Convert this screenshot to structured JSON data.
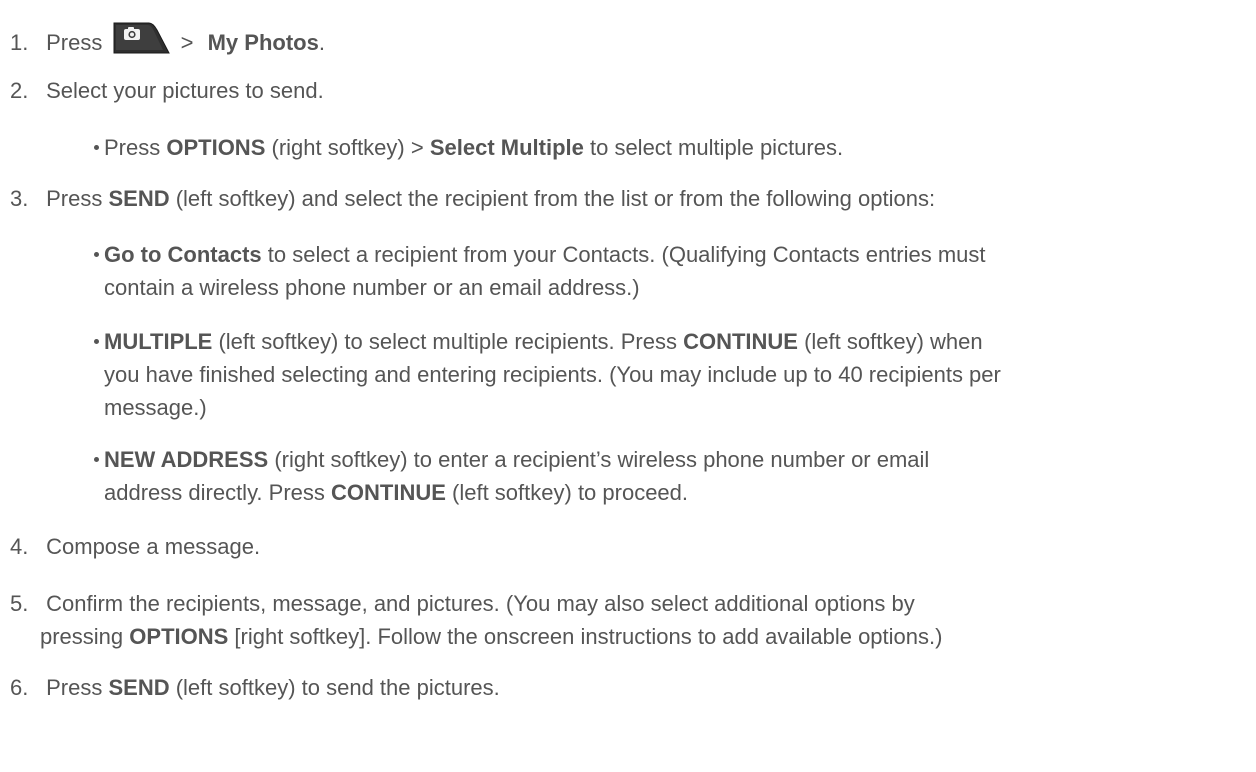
{
  "steps": [
    {
      "num": "1.",
      "pre": "Press",
      "key_icon": "camera-key-icon",
      "sep": ">",
      "bold": "My Photos",
      "post": "."
    },
    {
      "num": "2.",
      "text": "Select your pictures to send.",
      "bullets": [
        {
          "t1": "Press ",
          "b1": "OPTIONS",
          "t2": " (right softkey) > ",
          "b2": "Select Multiple",
          "t3": " to select multiple pictures."
        }
      ]
    },
    {
      "num": "3.",
      "pre": "Press ",
      "bold": "SEND",
      "post": " (left softkey) and select the recipient from the list or from the following options:",
      "bullets": [
        {
          "b1": "Go to Contacts",
          "t1": " to select a recipient from your Contacts. (Qualifying Contacts entries must",
          "t2": "contain a wireless phone number or an email address.)"
        },
        {
          "b1": "MULTIPLE",
          "t1": " (left softkey) to select multiple recipients. Press ",
          "b2": "CONTINUE",
          "t2": " (left softkey) when",
          "t3": "you have finished selecting and entering recipients. (You may include up to 40 recipients per",
          "t4": "message.)"
        },
        {
          "b1": "NEW ADDRESS",
          "t1": " (right softkey) to enter a recipient’s wireless phone number or email",
          "t2": "address directly. Press ",
          "b2": "CONTINUE",
          "t3": " (left softkey) to proceed."
        }
      ]
    },
    {
      "num": "4.",
      "text": "Compose a message."
    },
    {
      "num": "5.",
      "line1": "Confirm the recipients, message, and pictures. (You may also select additional options by",
      "pre2": "pressing ",
      "bold": "OPTIONS",
      "post2": " [right softkey]. Follow the onscreen instructions to add available options.)"
    },
    {
      "num": "6.",
      "pre": "Press ",
      "bold": "SEND",
      "post": " (left softkey) to send the pictures."
    }
  ],
  "colors": {
    "text": "#555555",
    "key_dark": "#2a2a2a"
  }
}
